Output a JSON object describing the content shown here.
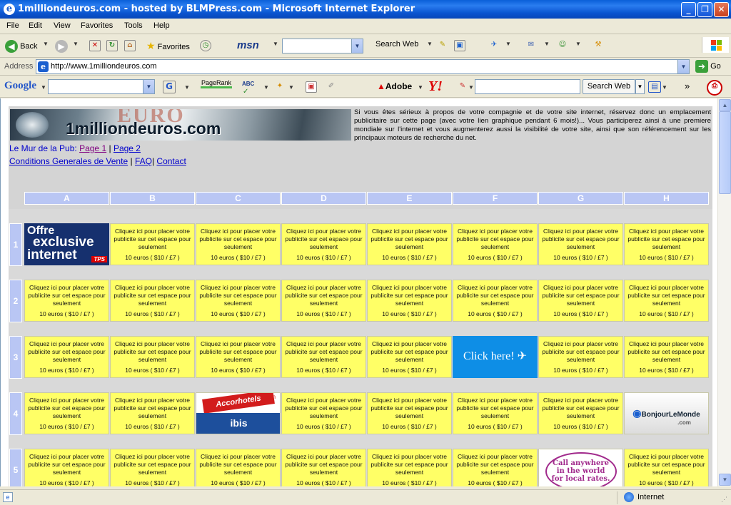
{
  "window": {
    "title": "1milliondeuros.com - hosted by BLMPress.com - Microsoft Internet Explorer"
  },
  "menu": [
    "File",
    "Edit",
    "View",
    "Favorites",
    "Tools",
    "Help"
  ],
  "toolbar": {
    "back": "Back",
    "favorites": "Favorites",
    "msn": "msn",
    "search_web": "Search Web"
  },
  "address": {
    "label": "Address",
    "url": "http://www.1milliondeuros.com",
    "go": "Go"
  },
  "googlebar": {
    "google": "Google",
    "pagerank": "PageRank",
    "abc": "ABC",
    "adobe": "Adobe",
    "yahoo": "Y!",
    "search_web": "Search Web"
  },
  "page": {
    "logo_text": "1milliondeuros.com",
    "logo_euro": "EURO",
    "intro": "Si vous êtes sérieux à propos de votre compagnie et de votre site internet, réservez donc un emplacement publicitaire sur cette page (avec votre lien graphique pendant 6 mois!)... Vous participerez ainsi à une premiere mondiale sur l'internet et vous augmenterez aussi la visibilité de votre site, ainsi que son référencement sur les principaux moteurs de recherche du net.",
    "wall_label": "Le Mur de la Pub:",
    "page1": "Page 1",
    "page2": "Page 2",
    "sep": "|",
    "cgv": "Conditions Generales de Vente",
    "faq": "FAQ",
    "contact": "Contact",
    "columns": [
      "A",
      "B",
      "C",
      "D",
      "E",
      "F",
      "G",
      "H"
    ],
    "rows": [
      "1",
      "2",
      "3",
      "4",
      "5"
    ],
    "ad_text": "Cliquez ici pour placer votre publicite sur cet espace pour seulement",
    "ad_price": "10 euros ( $10 / £7 )",
    "ads": {
      "offre": {
        "line1": "Offre",
        "line2": "exclusive",
        "line3": "internet",
        "badge": "TPS"
      },
      "clickhere": "Click here!",
      "accor": {
        "top": "Accorhotels",
        "com": ".com",
        "bottom": "ibis"
      },
      "bonjour": {
        "text": "BonjourLeMonde",
        "com": ".com"
      },
      "call": "Call anywhere in the world for local rates."
    }
  },
  "status": {
    "zone": "Internet"
  }
}
